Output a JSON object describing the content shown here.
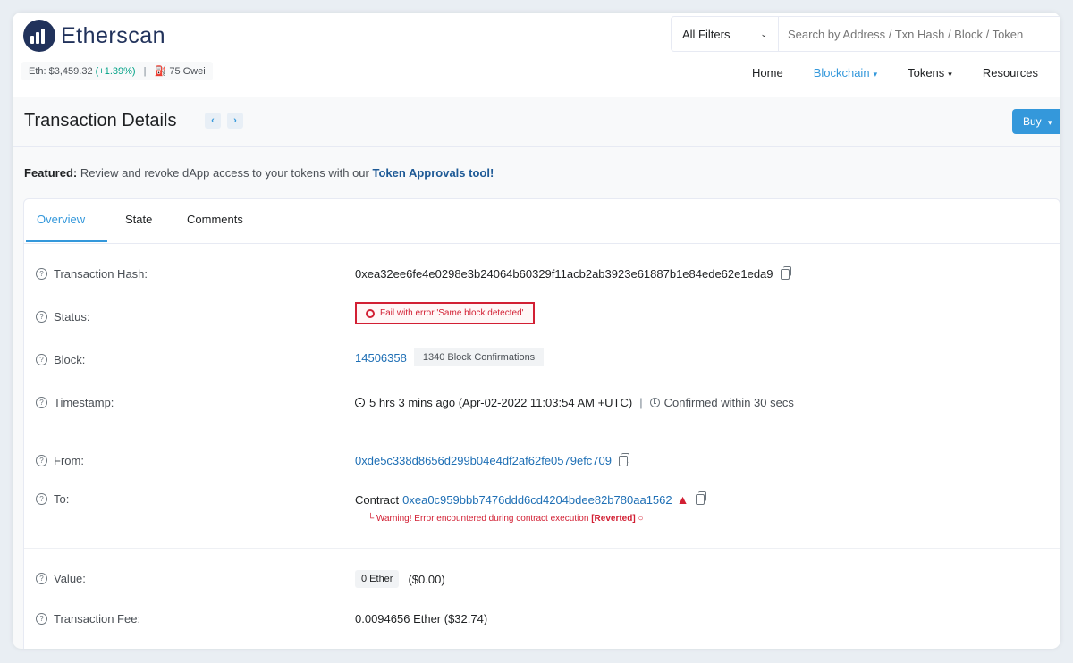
{
  "header": {
    "logo_text": "Etherscan",
    "eth_price_label": "Eth: $3,459.32",
    "eth_change": "(+1.39%)",
    "gas_sep": "|",
    "gas": "75 Gwei",
    "filter_label": "All Filters",
    "search_placeholder": "Search by Address / Txn Hash / Block / Token",
    "nav": [
      "Home",
      "Blockchain",
      "Tokens",
      "Resources"
    ]
  },
  "title": {
    "text": "Transaction Details",
    "prev": "‹",
    "next": "›",
    "buy": "Buy"
  },
  "featured": {
    "label": "Featured:",
    "text": "Review and revoke dApp access to your tokens with our",
    "link": "Token Approvals tool!"
  },
  "tabs": [
    "Overview",
    "State",
    "Comments"
  ],
  "details": {
    "hash_label": "Transaction Hash:",
    "hash": "0xea32ee6fe4e0298e3b24064b60329f11acb2ab3923e61887b1e84ede62e1eda9",
    "status_label": "Status:",
    "status": "Fail with error 'Same block detected'",
    "block_label": "Block:",
    "block": "14506358",
    "confirmations": "1340 Block Confirmations",
    "timestamp_label": "Timestamp:",
    "timestamp": "5 hrs 3 mins ago (Apr-02-2022 11:03:54 AM +UTC)",
    "confirmed": "Confirmed within 30 secs",
    "from_label": "From:",
    "from": "0xde5c338d8656d299b04e4df2af62fe0579efc709",
    "to_label": "To:",
    "to_prefix": "Contract",
    "to": "0xea0c959bbb7476ddd6cd4204bdee82b780aa1562",
    "warning_prefix": "Warning! Error encountered during contract execution",
    "warning_reverted": "[Reverted]",
    "value_label": "Value:",
    "value": "0 Ether",
    "value_usd": "($0.00)",
    "fee_label": "Transaction Fee:",
    "fee": "0.0094656 Ether ($32.74)"
  },
  "colors": {
    "accent": "#3498db",
    "error": "#d21f33",
    "brand": "#21325b"
  }
}
